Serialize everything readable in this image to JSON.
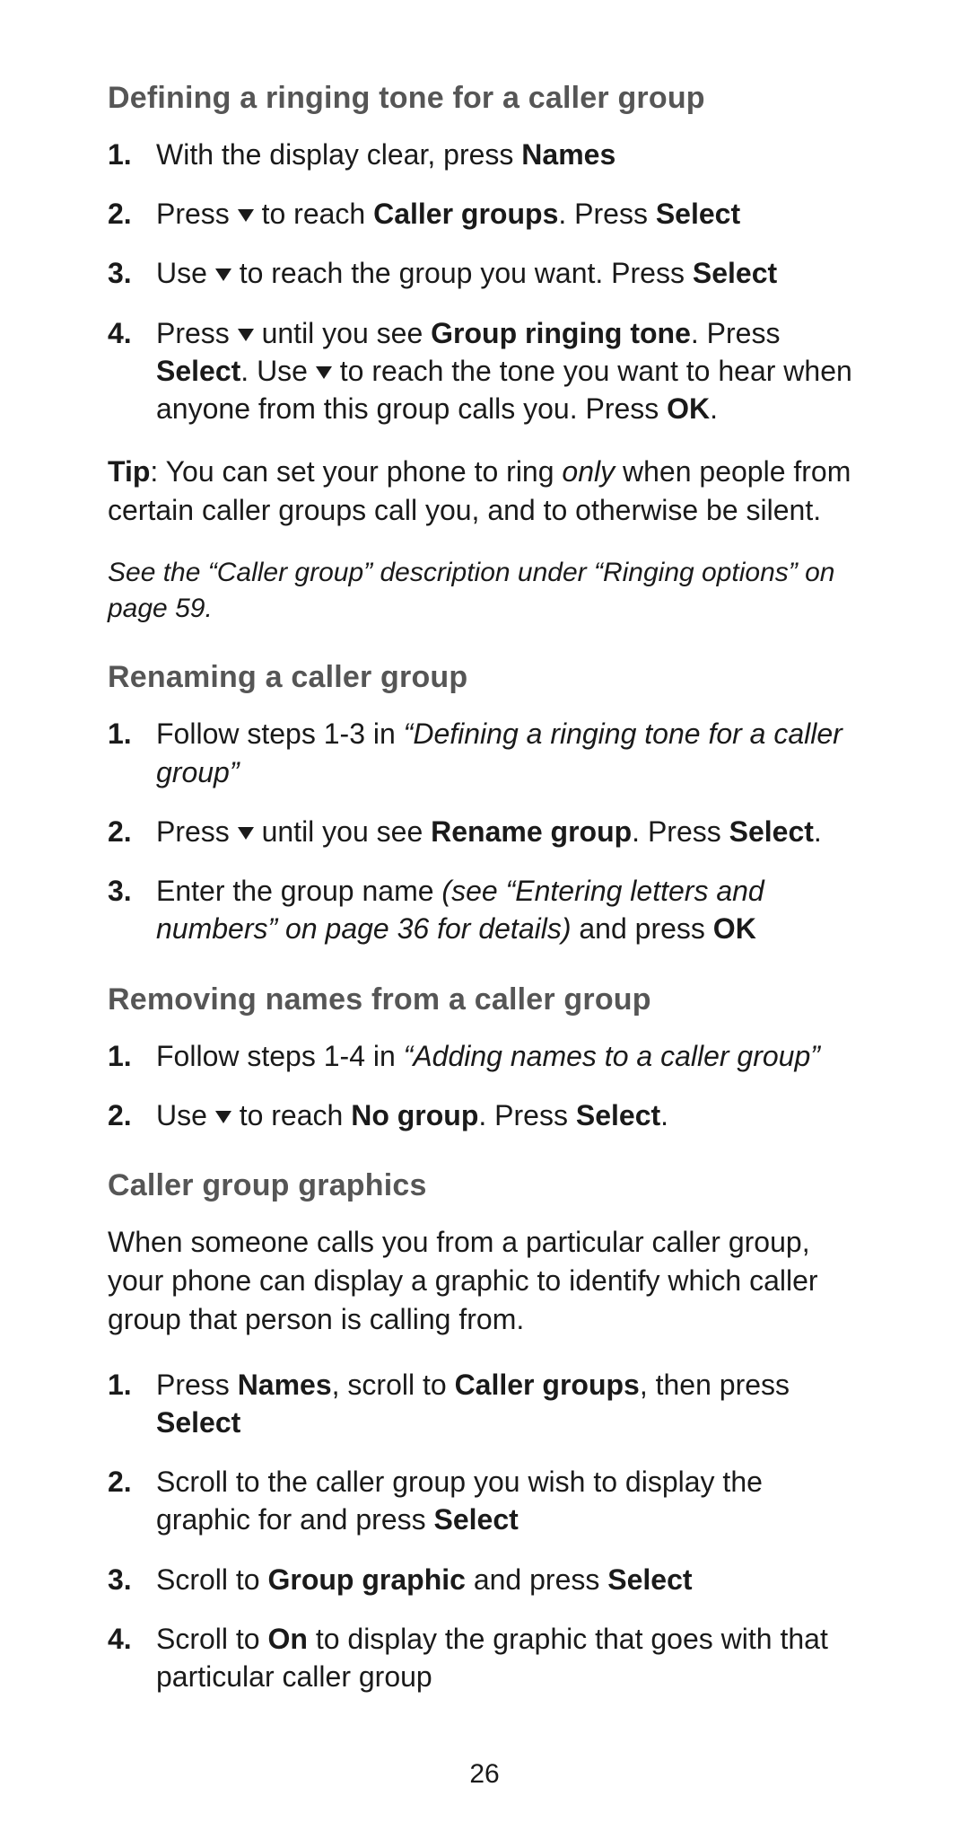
{
  "page_number": "26",
  "sections": {
    "defining": {
      "heading": "Defining a ringing tone for a caller group",
      "step1_num": "1.",
      "step1_a": "With the display clear, press ",
      "step1_b": "Names",
      "step2_num": "2.",
      "step2_a": "Press ",
      "step2_b": " to reach ",
      "step2_c": "Caller groups",
      "step2_d": ". Press ",
      "step2_e": "Select",
      "step3_num": "3.",
      "step3_a": "Use ",
      "step3_b": " to reach the group you want. Press ",
      "step3_c": "Select",
      "step4_num": "4.",
      "step4_a": "Press ",
      "step4_b": " until you see ",
      "step4_c": "Group ringing tone",
      "step4_d": ". Press ",
      "step4_e": "Select",
      "step4_f": ". Use ",
      "step4_g": " to reach the tone you want to hear when anyone from this group calls you. Press ",
      "step4_h": "OK",
      "step4_i": "."
    },
    "tip": {
      "label": "Tip",
      "body_a": ": You can set your phone to ring ",
      "body_b": "only",
      "body_c": " when people from certain caller groups call you, and to otherwise be silent."
    },
    "ref1": "See the “Caller group” description under “Ringing options” on page 59.",
    "renaming": {
      "heading": "Renaming a caller group",
      "step1_num": "1.",
      "step1_a": "Follow steps 1-3 in ",
      "step1_b": "“Defining a ringing tone for a caller group”",
      "step2_num": "2.",
      "step2_a": "Press ",
      "step2_b": " until you see ",
      "step2_c": "Rename group",
      "step2_d": ". Press ",
      "step2_e": "Select",
      "step2_f": ".",
      "step3_num": "3.",
      "step3_a": "Enter the group name ",
      "step3_b": "(see “Entering letters and numbers” on page 36 for details)",
      "step3_c": " and press ",
      "step3_d": "OK"
    },
    "removing": {
      "heading": "Removing names from a caller group",
      "step1_num": "1.",
      "step1_a": "Follow steps 1-4 in ",
      "step1_b": "“Adding names to a caller group”",
      "step2_num": "2.",
      "step2_a": "Use ",
      "step2_b": " to reach ",
      "step2_c": "No group",
      "step2_d": ". Press ",
      "step2_e": "Select",
      "step2_f": "."
    },
    "graphics": {
      "heading": "Caller group graphics",
      "intro": "When someone calls you from a particular caller group, your phone can display a graphic to identify which caller group that person is calling from.",
      "step1_num": "1.",
      "step1_a": "Press ",
      "step1_b": "Names",
      "step1_c": ", scroll to ",
      "step1_d": "Caller groups",
      "step1_e": ", then press ",
      "step1_f": "Select",
      "step2_num": "2.",
      "step2_a": "Scroll to the caller group you wish to display the graphic for and press ",
      "step2_b": "Select",
      "step3_num": "3.",
      "step3_a": "Scroll to ",
      "step3_b": "Group graphic",
      "step3_c": " and press ",
      "step3_d": "Select",
      "step4_num": "4.",
      "step4_a": "Scroll to ",
      "step4_b": "On",
      "step4_c": " to display the graphic that goes with that particular caller group"
    }
  }
}
